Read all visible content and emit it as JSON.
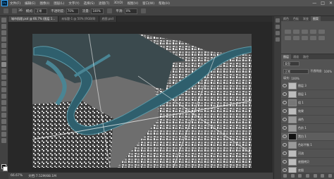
{
  "menubar": {
    "app_icon": "Ps",
    "items": [
      "文件(F)",
      "编辑(E)",
      "图像(I)",
      "图层(L)",
      "文字(Y)",
      "选择(S)",
      "滤镜(T)",
      "3D(D)",
      "视图(V)",
      "窗口(W)",
      "帮助(H)"
    ],
    "window_controls": [
      "—",
      "□",
      "✕"
    ]
  },
  "options": {
    "brush_size": "36",
    "mode_label": "模式:",
    "mode_value": "正常",
    "opacity_label": "不透明度:",
    "opacity_value": "70%",
    "flow_label": "流量:",
    "flow_value": "100%",
    "smooth_label": "平滑:",
    "smooth_value": "0%"
  },
  "tabs": [
    {
      "label": "城市肌理.psd @ 66.7% (图层 1...",
      "active": true
    },
    {
      "label": "未标题-1 @ 50% (RGB/8)",
      "active": false
    },
    {
      "label": "底图.psd",
      "active": false
    }
  ],
  "status": {
    "zoom": "66.67%",
    "doc": "文档:7.52M/88.1M"
  },
  "panel": {
    "top_tabs": [
      "颜色",
      "色板",
      "渐变",
      "图案"
    ],
    "layer_tabs": [
      "图层",
      "通道",
      "路径"
    ],
    "search_placeholder": "类型",
    "blend_mode": "正常",
    "opacity_label": "不透明度:",
    "opacity_value": "100%",
    "fill_label": "填充:",
    "fill_value": "100%",
    "layers": [
      {
        "name": "图层 3"
      },
      {
        "name": "图层 1"
      },
      {
        "name": "组 1"
      },
      {
        "name": "效果"
      },
      {
        "name": "调色"
      },
      {
        "name": "色阶 1"
      },
      {
        "name": "黑白 1"
      },
      {
        "name": "色彩平衡 1"
      },
      {
        "name": "河流"
      },
      {
        "name": "底图拷贝"
      },
      {
        "name": "底图"
      }
    ]
  }
}
